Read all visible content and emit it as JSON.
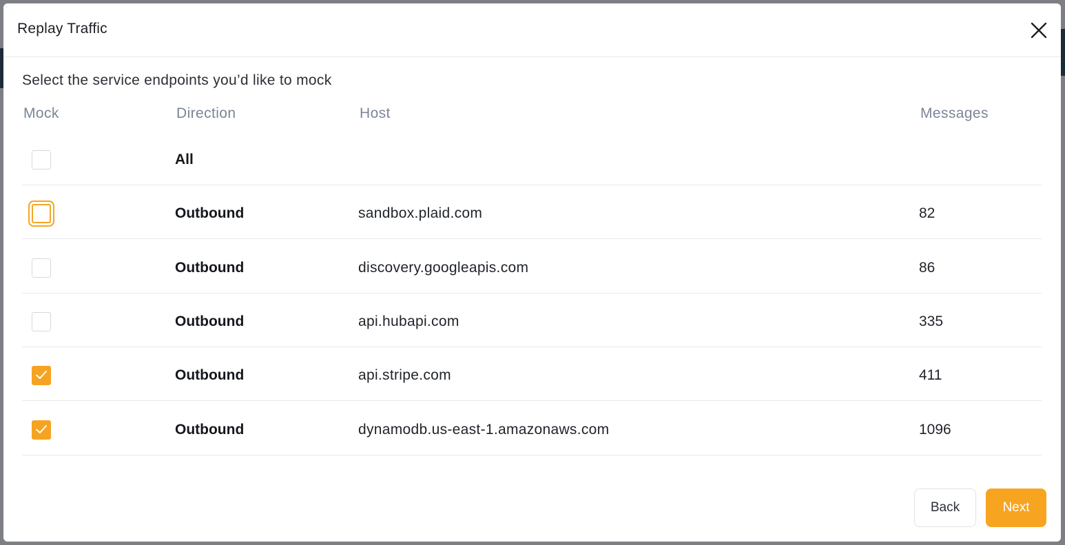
{
  "modal": {
    "title": "Replay Traffic",
    "subtitle": "Select the service endpoints you’d like to mock",
    "close_icon": "close-icon"
  },
  "table": {
    "headers": {
      "mock": "Mock",
      "direction": "Direction",
      "host": "Host",
      "messages": "Messages"
    },
    "all_label": "All",
    "rows": [
      {
        "direction": "Outbound",
        "host": "sandbox.plaid.com",
        "messages": "82",
        "checked": false
      },
      {
        "direction": "Outbound",
        "host": "discovery.googleapis.com",
        "messages": "86",
        "checked": false
      },
      {
        "direction": "Outbound",
        "host": "api.hubapi.com",
        "messages": "335",
        "checked": false
      },
      {
        "direction": "Outbound",
        "host": "api.stripe.com",
        "messages": "411",
        "checked": true
      },
      {
        "direction": "Outbound",
        "host": "dynamodb.us-east-1.amazonaws.com",
        "messages": "1096",
        "checked": true
      }
    ]
  },
  "footer": {
    "back_label": "Back",
    "next_label": "Next"
  },
  "colors": {
    "accent": "#f7a421",
    "header_text": "#7b8596"
  }
}
